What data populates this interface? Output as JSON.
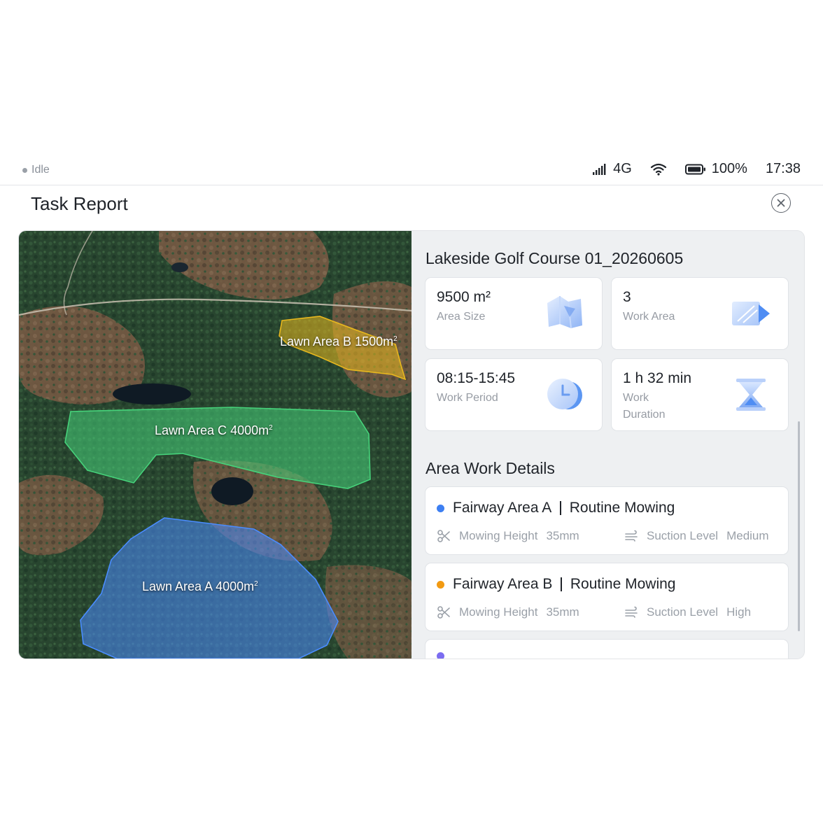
{
  "status": {
    "state": "Idle",
    "network": "4G",
    "battery": "100%",
    "time": "17:38"
  },
  "header": {
    "title": "Task Report"
  },
  "map": {
    "labels": [
      {
        "name": "Lawn Area B",
        "area": "1500m",
        "sup": "2",
        "color": "#e8b81e"
      },
      {
        "name": "Lawn Area C",
        "area": "4000m",
        "sup": "2",
        "color": "#46d27a"
      },
      {
        "name": "Lawn Area A",
        "area": "4000m",
        "sup": "2",
        "color": "#4a8cff"
      }
    ]
  },
  "report": {
    "course_title": "Lakeside Golf Course 01_20260605",
    "stats": [
      {
        "value": "9500 m²",
        "label": "Area Size",
        "icon": "area-size-icon"
      },
      {
        "value": "3",
        "label": "Work Area",
        "icon": "work-area-icon"
      },
      {
        "value": "08:15-15:45",
        "label": "Work Period",
        "icon": "clock-icon"
      },
      {
        "value": "1 h 32 min",
        "label": "Work Duration",
        "icon": "hourglass-icon"
      }
    ],
    "details_title": "Area Work Details",
    "areas": [
      {
        "name": "Fairway Area A",
        "mode": "Routine Mowing",
        "dot_color": "#3d7ff2",
        "height_label": "Mowing Height",
        "height_value": "35mm",
        "suction_label": "Suction Level",
        "suction_value": "Medium"
      },
      {
        "name": "Fairway Area B",
        "mode": "Routine Mowing",
        "dot_color": "#f29a12",
        "height_label": "Mowing Height",
        "height_value": "35mm",
        "suction_label": "Suction Level",
        "suction_value": "High"
      }
    ]
  }
}
